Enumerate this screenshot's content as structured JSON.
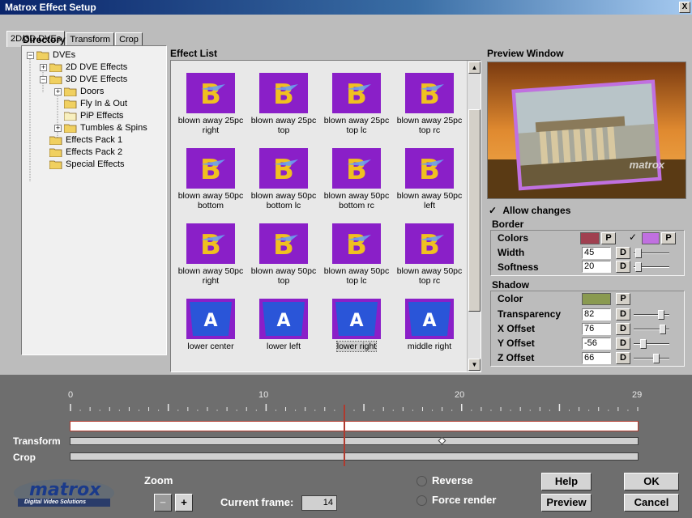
{
  "window": {
    "title": "Matrox Effect Setup",
    "close": "X"
  },
  "tabs": [
    {
      "label": "2D/3D DVEs"
    },
    {
      "label": "Transform"
    },
    {
      "label": "Crop"
    }
  ],
  "directory": {
    "label": "Directory",
    "nodes": [
      {
        "label": "DVEs",
        "pm": "−"
      },
      {
        "label": "2D DVE Effects",
        "pm": "+"
      },
      {
        "label": "3D DVE Effects",
        "pm": "−"
      },
      {
        "label": "Doors",
        "pm": "+"
      },
      {
        "label": "Fly In & Out",
        "pm": ""
      },
      {
        "label": "PiP Effects",
        "pm": ""
      },
      {
        "label": "Tumbles & Spins",
        "pm": "+"
      },
      {
        "label": "Effects Pack 1",
        "pm": ""
      },
      {
        "label": "Effects Pack 2",
        "pm": ""
      },
      {
        "label": "Special Effects",
        "pm": ""
      }
    ]
  },
  "effect_list": {
    "label": "Effect List",
    "scroll_up": "▲",
    "scroll_down": "▼",
    "items": [
      {
        "line1": "blown away 25pc",
        "line2": "right",
        "glyph": "B"
      },
      {
        "line1": "blown away 25pc",
        "line2": "top",
        "glyph": "B"
      },
      {
        "line1": "blown away 25pc",
        "line2": "top lc",
        "glyph": "B"
      },
      {
        "line1": "blown away 25pc",
        "line2": "top rc",
        "glyph": "B"
      },
      {
        "line1": "blown away 50pc",
        "line2": "bottom",
        "glyph": "B"
      },
      {
        "line1": "blown away 50pc",
        "line2": "bottom lc",
        "glyph": "B"
      },
      {
        "line1": "blown away 50pc",
        "line2": "bottom rc",
        "glyph": "B"
      },
      {
        "line1": "blown away 50pc",
        "line2": "left",
        "glyph": "B"
      },
      {
        "line1": "blown away 50pc",
        "line2": "right",
        "glyph": "B"
      },
      {
        "line1": "blown away 50pc",
        "line2": "top",
        "glyph": "B"
      },
      {
        "line1": "blown away 50pc",
        "line2": "top lc",
        "glyph": "B"
      },
      {
        "line1": "blown away 50pc",
        "line2": "top rc",
        "glyph": "B"
      },
      {
        "line1": "lower center",
        "line2": "",
        "glyph": "A"
      },
      {
        "line1": "lower left",
        "line2": "",
        "glyph": "A"
      },
      {
        "line1": "lower right",
        "line2": "",
        "glyph": "A"
      },
      {
        "line1": "middle right",
        "line2": "",
        "glyph": "A"
      }
    ],
    "selected": "lower right"
  },
  "preview": {
    "label": "Preview Window",
    "logo_text": "matrox"
  },
  "allow_changes": {
    "label": "Allow changes",
    "checked": true,
    "check_glyph": "✓"
  },
  "border": {
    "label": "Border",
    "colors_label": "Colors",
    "color1": "#a04050",
    "color2": "#c070e0",
    "color2_checked": true,
    "p_label": "P",
    "check_glyph": "✓",
    "width_label": "Width",
    "width_value": "45",
    "softness_label": "Softness",
    "softness_value": "20",
    "d_label": "D"
  },
  "shadow": {
    "label": "Shadow",
    "color_label": "Color",
    "color": "#8a9a50",
    "p_label": "P",
    "d_label": "D",
    "rows": [
      {
        "label": "Transparency",
        "value": "82",
        "level": 0.82
      },
      {
        "label": "X Offset",
        "value": "76",
        "level": 0.88
      },
      {
        "label": "Y Offset",
        "value": "-56",
        "level": 0.22
      },
      {
        "label": "Z Offset",
        "value": "66",
        "level": 0.66
      }
    ]
  },
  "timeline": {
    "tick_labels": [
      "0",
      "10",
      "20",
      "29"
    ],
    "tracks": [
      {
        "label": "Transform"
      },
      {
        "label": "Crop"
      }
    ],
    "current_frame": 14,
    "total_frames": 29,
    "transform_keyframe": 19
  },
  "bottom": {
    "logo": "matrox",
    "logo_sub": "Digital Video Solutions",
    "zoom_label": "Zoom",
    "zoom_minus": "−",
    "zoom_plus": "+",
    "current_frame_label": "Current frame:",
    "current_frame_value": "14",
    "reverse_label": "Reverse",
    "force_render_label": "Force render",
    "help": "Help",
    "preview": "Preview",
    "ok": "OK",
    "cancel": "Cancel"
  },
  "colors": {
    "accent_purple": "#8a1fc8",
    "thumb_blue": "#2a55d8",
    "timeline_bg": "#6e6e6e",
    "playhead": "#b03a2e"
  }
}
